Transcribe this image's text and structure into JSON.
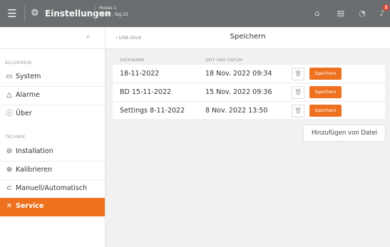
{
  "topbar": {
    "menu_icon": "hamburger-icon",
    "settings_icon": "sliders-icon",
    "title": "Einstellungen",
    "house": "House 1",
    "datetime": "18:37, Tag 22",
    "icons": [
      "home-icon",
      "calculator-icon",
      "signal-icon",
      "bell-icon"
    ],
    "notification_count": "1"
  },
  "sidebar": {
    "search_icon": "search-icon",
    "section_general": "ALLGEMEIN",
    "section_technik": "TECHNIK",
    "items": [
      {
        "label": "System",
        "icon": "monitor-icon"
      },
      {
        "label": "Alarme",
        "icon": "bell-icon"
      },
      {
        "label": "Über",
        "icon": "info-icon"
      },
      {
        "label": "Installation",
        "icon": "install-icon"
      },
      {
        "label": "Kalibrieren",
        "icon": "calibrate-icon"
      },
      {
        "label": "Manuell/Automatisch",
        "icon": "toggle-icon"
      },
      {
        "label": "Service",
        "icon": "wrench-icon"
      }
    ],
    "active_color": "#ee7120"
  },
  "main": {
    "breadcrumb": "‹ USB-Stick",
    "title": "Speichern",
    "headers": [
      "DATEINAME",
      "ZEIT UND DATUM"
    ],
    "rows": [
      {
        "name": "18-11-2022",
        "date": "18 Nov. 2022 09:34",
        "action": "Speichern"
      },
      {
        "name": "BD 15-11-2022",
        "date": "15 Nov. 2022 09:36",
        "action": "Speichern"
      },
      {
        "name": "Settings 8-11-2022",
        "date": "8 Nov. 2022 13:50",
        "action": "Speichern"
      }
    ],
    "add_from_file": "Hinzufügen von Datei"
  }
}
